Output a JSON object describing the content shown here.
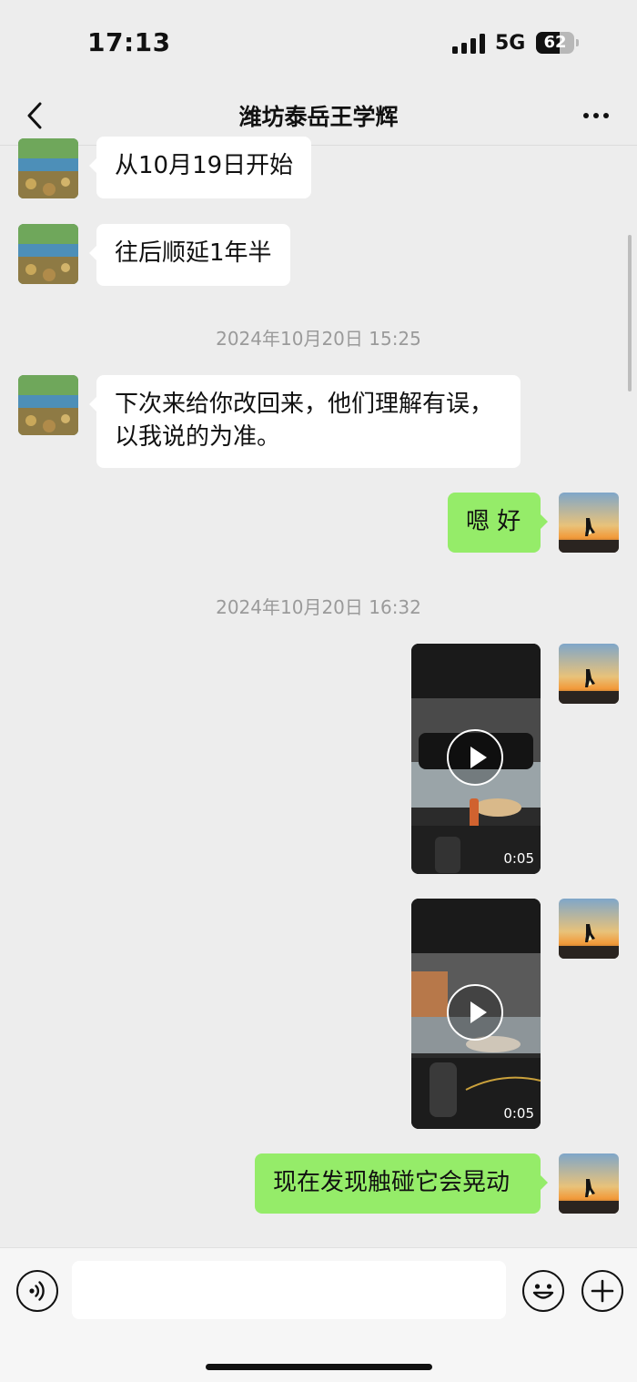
{
  "status_bar": {
    "time": "17:13",
    "network": "5G",
    "battery": "62",
    "battery_level": 0.62
  },
  "header": {
    "title": "潍坊泰岳王学辉"
  },
  "messages": [
    {
      "type": "text",
      "direction": "incoming",
      "text": "从10月19日开始"
    },
    {
      "type": "text",
      "direction": "incoming",
      "text": "往后顺延1年半"
    },
    {
      "type": "timestamp",
      "text": "2024年10月20日 15:25"
    },
    {
      "type": "text",
      "direction": "incoming",
      "text": "下次来给你改回来，他们理解有误，以我说的为准。"
    },
    {
      "type": "text",
      "direction": "outgoing",
      "text": "嗯 好"
    },
    {
      "type": "timestamp",
      "text": "2024年10月20日 16:32"
    },
    {
      "type": "video",
      "direction": "outgoing",
      "duration": "0:05"
    },
    {
      "type": "video",
      "direction": "outgoing",
      "duration": "0:05"
    },
    {
      "type": "text",
      "direction": "outgoing",
      "text": "现在发现触碰它会晃动"
    }
  ],
  "input_bar": {
    "placeholder": ""
  },
  "icons": {
    "back": "chevron-left-icon",
    "more": "more-dots-icon",
    "voice": "voice-icon",
    "emoji": "emoji-icon",
    "add": "plus-icon",
    "play": "play-icon"
  },
  "colors": {
    "background": "#ededed",
    "outgoing_bubble": "#95ec69",
    "incoming_bubble": "#ffffff"
  }
}
